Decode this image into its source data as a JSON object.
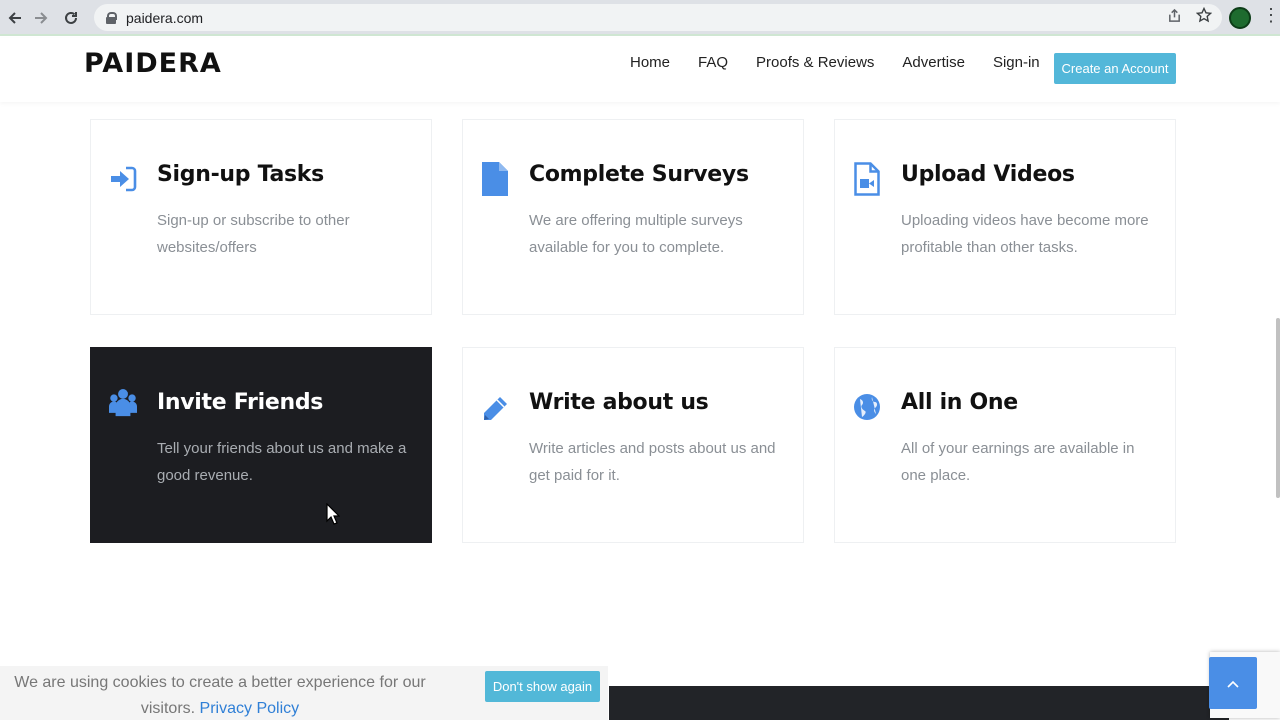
{
  "browser": {
    "url": "paidera.com",
    "back_icon": "back-arrow-icon",
    "forward_icon": "forward-arrow-icon",
    "reload_icon": "reload-icon"
  },
  "header": {
    "logo": "PAIDERA",
    "nav": [
      "Home",
      "FAQ",
      "Proofs & Reviews",
      "Advertise",
      "Sign-in"
    ],
    "cta": "Create an Account"
  },
  "cards": [
    {
      "title": "Sign-up Tasks",
      "desc": "Sign-up or subscribe to other websites/offers",
      "icon": "sign-in-icon"
    },
    {
      "title": "Complete Surveys",
      "desc": "We are offering multiple surveys available for you to complete.",
      "icon": "document-icon"
    },
    {
      "title": "Upload Videos",
      "desc": "Uploading videos have become more profitable than other tasks.",
      "icon": "video-file-icon"
    },
    {
      "title": "Invite Friends",
      "desc": "Tell your friends about us and make a good revenue.",
      "icon": "users-icon"
    },
    {
      "title": "Write about us",
      "desc": "Write articles and posts about us and get paid for it.",
      "icon": "pencil-icon"
    },
    {
      "title": "All in One",
      "desc": "All of your earnings are available in one place.",
      "icon": "globe-icon"
    }
  ],
  "cookie": {
    "message": "We are using cookies to create a better experience for our visitors.",
    "link": "Privacy Policy",
    "button": "Don't show again"
  },
  "colors": {
    "accent": "#53b7d9",
    "icon_blue": "#4a8ee6",
    "dark_card": "#1c1d21"
  }
}
